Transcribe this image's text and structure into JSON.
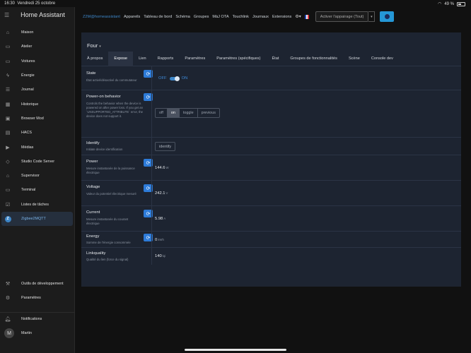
{
  "status_bar": {
    "time": "16:30",
    "date": "Vendredi 25 octobre",
    "battery": "49 %",
    "battery_level": 0.49
  },
  "sidebar": {
    "title": "Home Assistant",
    "items": [
      {
        "label": "Maison",
        "icon": "home-icon",
        "glyph": "⌂"
      },
      {
        "label": "Atelier",
        "icon": "card-icon",
        "glyph": "▭"
      },
      {
        "label": "Voitures",
        "icon": "card-icon",
        "glyph": "▭"
      },
      {
        "label": "Énergie",
        "icon": "lightning-icon",
        "glyph": "ϟ"
      },
      {
        "label": "Journal",
        "icon": "list-icon",
        "glyph": "☰"
      },
      {
        "label": "Historique",
        "icon": "chart-icon",
        "glyph": "▦"
      },
      {
        "label": "Browser Mod",
        "icon": "browser-icon",
        "glyph": "▣"
      },
      {
        "label": "HACS",
        "icon": "hacs-icon",
        "glyph": "▤"
      },
      {
        "label": "Médias",
        "icon": "media-icon",
        "glyph": "▶"
      },
      {
        "label": "Studio Code Server",
        "icon": "code-icon",
        "glyph": "◇"
      },
      {
        "label": "Supervisor",
        "icon": "supervisor-icon",
        "glyph": "⌂"
      },
      {
        "label": "Terminal",
        "icon": "terminal-icon",
        "glyph": "▭"
      },
      {
        "label": "Listes de tâches",
        "icon": "checklist-icon",
        "glyph": "☑"
      },
      {
        "label": "Zigbee2MQTT",
        "icon": "zigbee-icon",
        "glyph": "Z"
      }
    ],
    "dev_tools": "Outils de développement",
    "settings": "Paramètres",
    "notifications": "Notifications",
    "user": "Martin",
    "user_initial": "M"
  },
  "topnav": {
    "brand": "Z2M@homeassistant",
    "links": [
      "Appareils",
      "Tableau de bord",
      "Schéma",
      "Groupes",
      "MàJ OTA",
      "Touchlink",
      "Journaux",
      "Extensions"
    ],
    "pairing_label": "Activer l'appairage (Tout)"
  },
  "device": {
    "name": "Four",
    "tabs": [
      "À propos",
      "Expose",
      "Lien",
      "Rapports",
      "Paramètres",
      "Paramètres (spécifiques)",
      "État",
      "Groupes de fonctionnalités",
      "Scène",
      "Console dev"
    ],
    "active_tab": "Expose"
  },
  "exposes": {
    "state": {
      "label": "State",
      "desc": "État activé/désactivé du commutateur",
      "off": "OFF",
      "on": "ON"
    },
    "power_on": {
      "label": "Power-on behavior",
      "desc": "Controls the behavior when the device is powered on after power loss. If you get an `UNSUPPORTED_ATTRIBUTE` error, the device does not support it.",
      "options": [
        "off",
        "on",
        "toggle",
        "previous"
      ],
      "selected": "on"
    },
    "identify": {
      "label": "Identify",
      "desc": "Initiate device identification",
      "button": "identify"
    },
    "power": {
      "label": "Power",
      "desc": "Mesure instantanée de la puissance électrique",
      "value": "144.6",
      "unit": "W"
    },
    "voltage": {
      "label": "Voltage",
      "desc": "Valeur du potentiel électrique mesuré",
      "value": "242.1",
      "unit": "V"
    },
    "current": {
      "label": "Current",
      "desc": "Mesure instantanée du courant électrique",
      "value": "5.98",
      "unit": "A"
    },
    "energy": {
      "label": "Energy",
      "desc": "Somme de l'énergie consommée",
      "value": "0",
      "unit": "kWh"
    },
    "linkquality": {
      "label": "Linkquality",
      "desc": "Qualité du lien (force du signal)",
      "value": "140",
      "unit": "lqi"
    }
  }
}
